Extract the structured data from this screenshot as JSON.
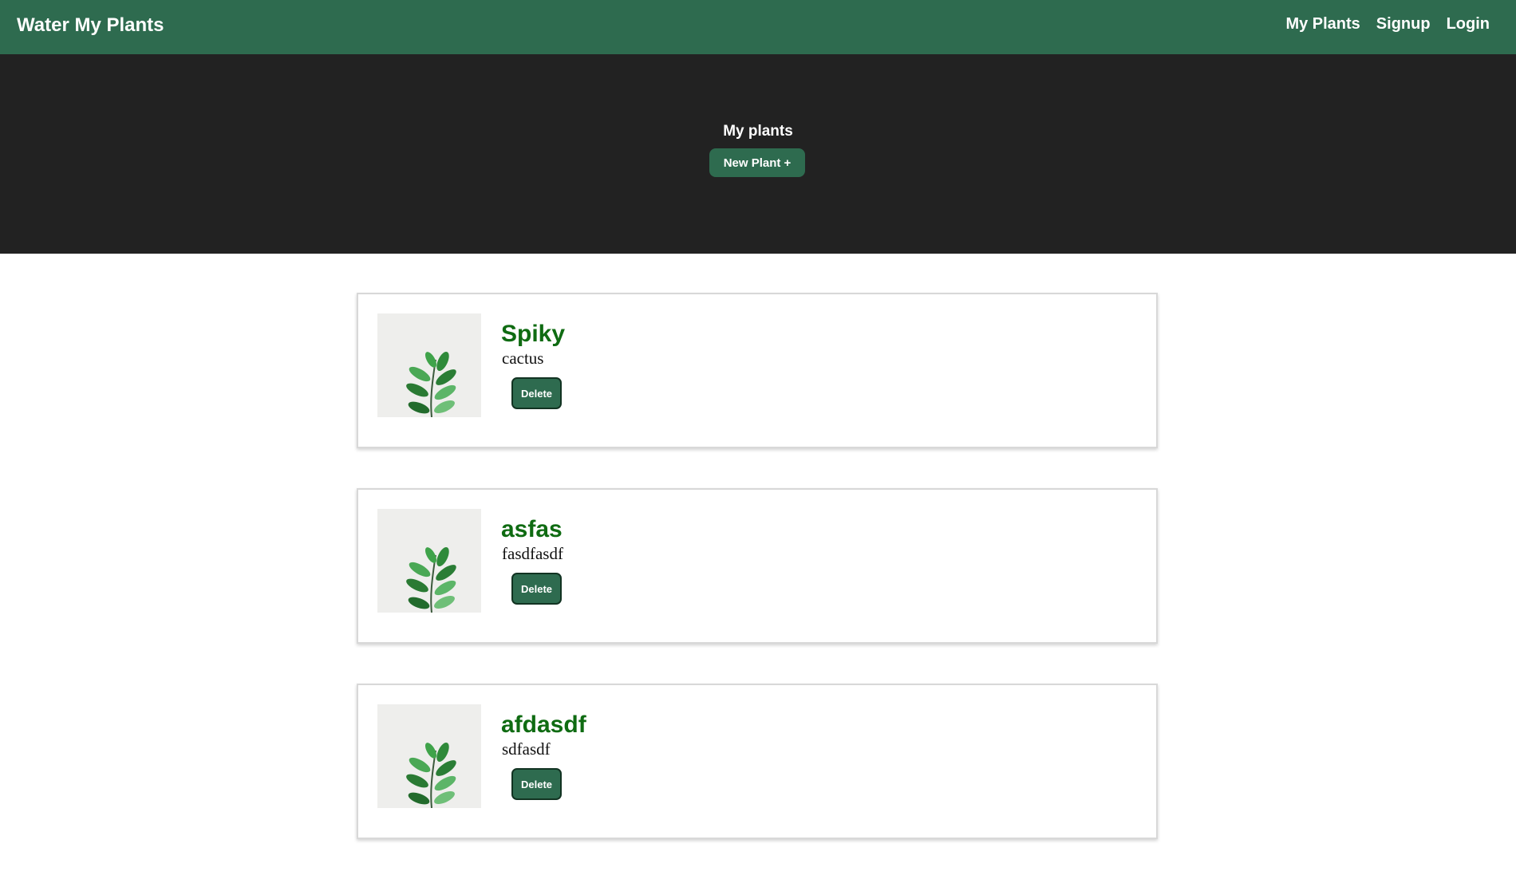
{
  "navbar": {
    "brand": "Water My Plants",
    "links": [
      {
        "label": "My Plants"
      },
      {
        "label": "Signup"
      },
      {
        "label": "Login"
      }
    ]
  },
  "hero": {
    "title": "My plants",
    "new_plant_button": "New Plant +"
  },
  "plants": [
    {
      "name": "Spiky",
      "species": "cactus",
      "delete_label": "Delete",
      "image_icon": "plant-photo-icon"
    },
    {
      "name": "asfas",
      "species": "fasdfasdf",
      "delete_label": "Delete",
      "image_icon": "plant-photo-icon"
    },
    {
      "name": "afdasdf",
      "species": "sdfasdf",
      "delete_label": "Delete",
      "image_icon": "plant-photo-icon"
    }
  ],
  "colors": {
    "primary_green": "#2e6b4f",
    "hero_background": "#222222",
    "plant_name_green": "#0f6b12"
  }
}
